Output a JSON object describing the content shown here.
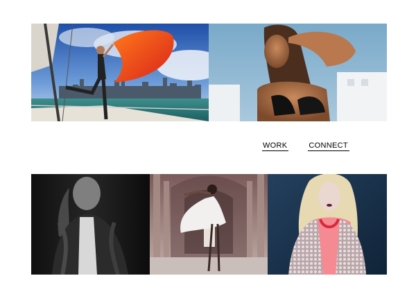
{
  "nav": {
    "items": [
      {
        "label": "WORK"
      },
      {
        "label": "CONNECT"
      }
    ]
  },
  "gallery": {
    "top_row": [
      {
        "subject": "model-with-orange-scarf-on-sailboat"
      },
      {
        "subject": "model-shading-eyes-black-top"
      }
    ],
    "bottom_row": [
      {
        "subject": "model-in-leather-jacket-monochrome"
      },
      {
        "subject": "model-in-white-dress-in-arcade"
      },
      {
        "subject": "model-in-sequin-jacket-pink-shirt"
      }
    ]
  },
  "colors": {
    "background": "#ffffff",
    "nav_text": "#000000"
  }
}
